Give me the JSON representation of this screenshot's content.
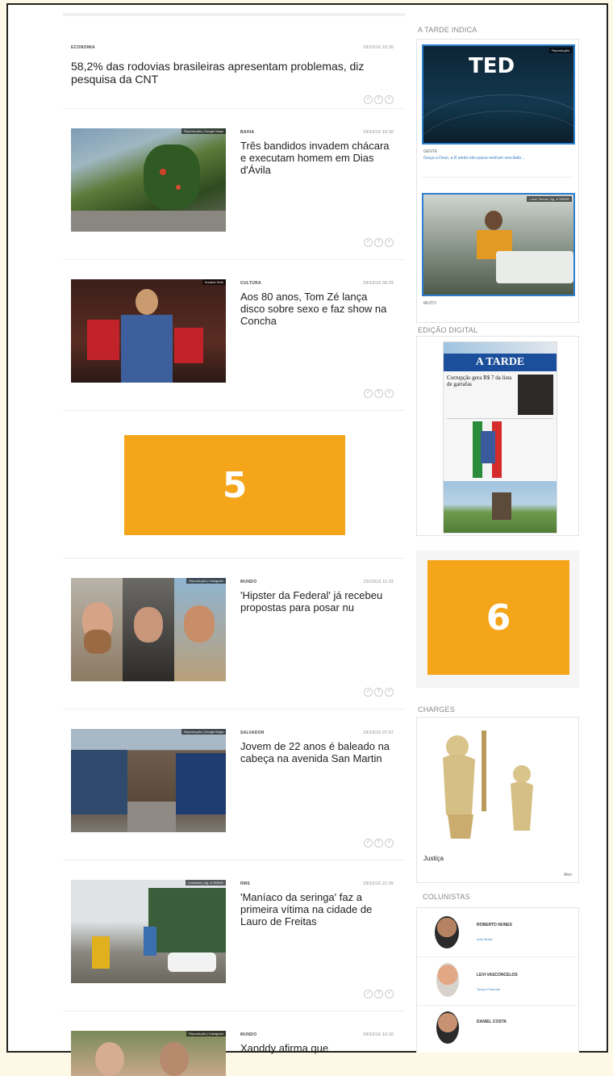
{
  "feed": [
    {
      "section": "ECONOMIA",
      "date": "29/10/16 10:30",
      "title": "58,2% das rodovias brasileiras apresentam problemas, diz pesquisa da CNT"
    },
    {
      "section": "BAHIA",
      "date": "29/10/16 10:30",
      "title": "Três bandidos invadem chácara e executam homem em Dias d'Ávila",
      "credit": "Reprodução | Google Maps"
    },
    {
      "section": "CULTURA",
      "date": "29/10/16 09:29",
      "title": "Aos 80 anos, Tom Zé lança disco sobre sexo e faz show na Concha",
      "credit": "Arnaldo Sete"
    },
    {
      "section": "MUNDO",
      "date": "29/10/16 11:33",
      "title": "'Hipster da Federal' já recebeu propostas para posar nu",
      "credit": "Reprodução | Instagram"
    },
    {
      "section": "SALVADOR",
      "date": "29/10/16 07:57",
      "title": "Jovem de 22 anos é baleado na cabeça na avenida San Martin",
      "credit": "Reprodução | Google Maps"
    },
    {
      "section": "RMS",
      "date": "29/10/16 21:09",
      "title": "'Maníaco da seringa' faz a primeira vítima na cidade de Lauro de Freitas",
      "credit": "Leonardo | Ag. A TARDE"
    },
    {
      "section": "MUNDO",
      "date": "29/10/16 10:10",
      "title": "Xanddy afirma que",
      "credit": "Reprodução | Instagram"
    }
  ],
  "ads": {
    "a5": "5",
    "a6": "6"
  },
  "share_icons": [
    "✓",
    "f",
    "+"
  ],
  "sidebar": {
    "indica_title": "A TARDE INDICA",
    "indica": [
      {
        "credit": "Reprodução",
        "logo": "TED",
        "tag": "GENTE",
        "text": "Graça a Deus, a R ainda não passa nenhum vexcilado..."
      },
      {
        "credit": "Lúcio Távora | Ag. A TARDE",
        "tag": "MUITO",
        "text": ""
      }
    ],
    "digital_title": "EDIÇÃO DIGITAL",
    "paper_masthead": "A TARDE",
    "paper_headline": "Corrupção gera R$ 7 da lista de garrafas",
    "charges_title": "CHARGES",
    "charge_caption": "Justiça",
    "charge_author": "Aleo",
    "colunistas_title": "COLUNISTAS",
    "colunistas": [
      {
        "name": "ROBERTO NUNES",
        "sub": "Auto Brasil"
      },
      {
        "name": "LEVI VASCONCELOS",
        "sub": "Tempo Presente"
      },
      {
        "name": "DANIEL COSTA",
        "sub": ""
      }
    ]
  }
}
